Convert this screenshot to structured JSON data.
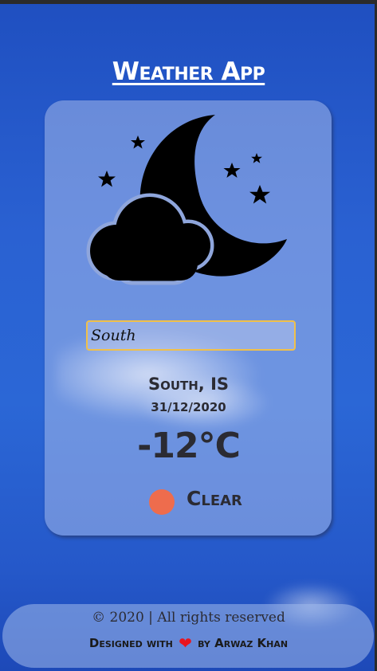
{
  "app": {
    "title": "Weather App"
  },
  "search": {
    "value": "South"
  },
  "weather": {
    "location": "South, IS",
    "date": "31/12/2020",
    "temperature": "-12°C",
    "condition": "Clear",
    "icon": "moon-cloud-stars-icon",
    "status_color": "#ee6c4d"
  },
  "footer": {
    "copyright": "© 2020 | All rights reserved",
    "designed_with": "Designed with",
    "heart": "❤",
    "by": "by",
    "author": "Arwaz Khan"
  },
  "colors": {
    "background": "#2a61d2",
    "input_border": "#f0c04a",
    "heart": "#e8141e"
  }
}
